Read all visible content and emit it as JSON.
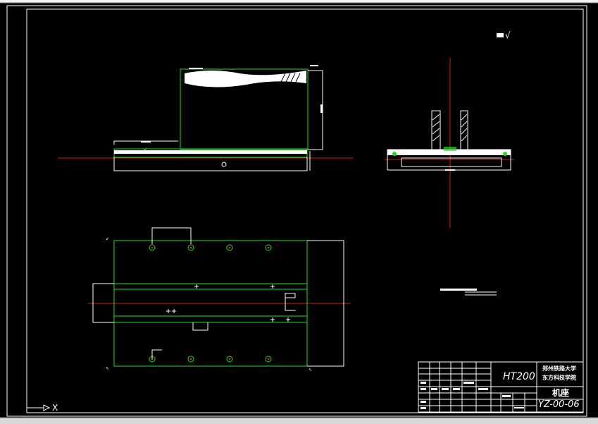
{
  "drawing": {
    "background": "#000000",
    "colors": {
      "outline": "#ffffff",
      "part": "#22dd22",
      "centerline": "#cc2222",
      "hatch": "#ffffff"
    },
    "roughness_symbol": "√",
    "ucs_axis_label": "X"
  },
  "title_block": {
    "material": "HT200",
    "school_line1": "郑州铁路大学",
    "school_line2": "东方科技学院",
    "part_name": "机座",
    "drawing_number": "YZ-00-06"
  }
}
